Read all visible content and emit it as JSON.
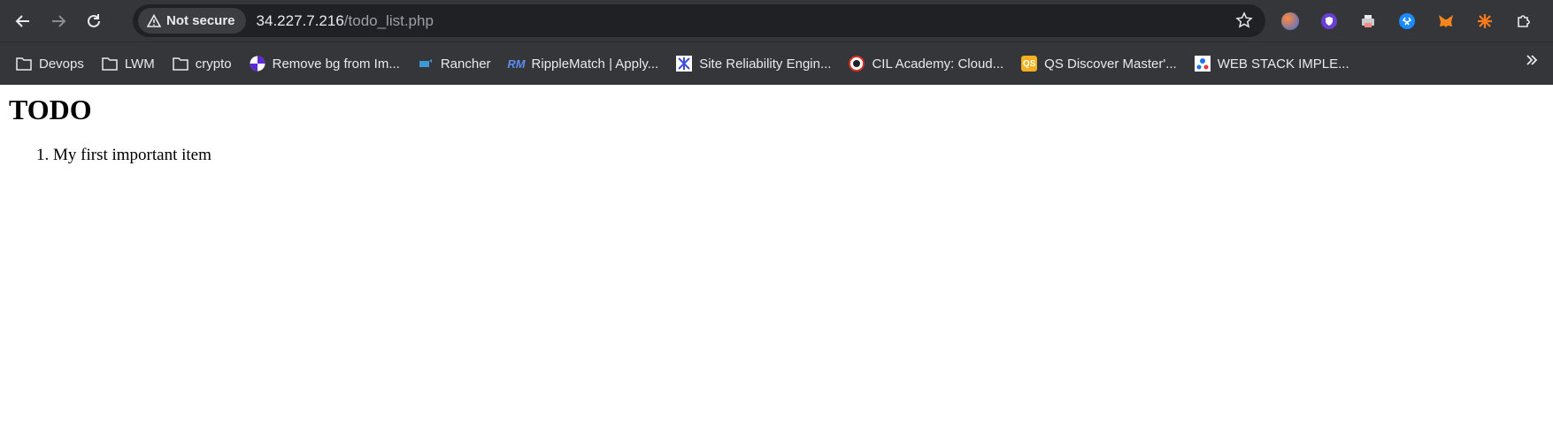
{
  "browser": {
    "security_label": "Not secure",
    "url_host": "34.227.7.216",
    "url_path": "/todo_list.php"
  },
  "bookmarks": [
    {
      "label": "Devops",
      "icon": "folder-icon"
    },
    {
      "label": "LWM",
      "icon": "folder-icon"
    },
    {
      "label": "crypto",
      "icon": "folder-icon"
    },
    {
      "label": "Remove bg from Im...",
      "icon": "removebg-icon"
    },
    {
      "label": "Rancher",
      "icon": "rancher-icon"
    },
    {
      "label": "RippleMatch | Apply...",
      "icon": "ripplematch-icon"
    },
    {
      "label": "Site Reliability Engin...",
      "icon": "sre-icon"
    },
    {
      "label": "CIL Academy: Cloud...",
      "icon": "cil-icon"
    },
    {
      "label": "QS Discover Master'...",
      "icon": "qs-icon"
    },
    {
      "label": "WEB STACK IMPLE...",
      "icon": "webstack-icon"
    }
  ],
  "page": {
    "title": "TODO",
    "items": [
      "My first important item"
    ]
  }
}
